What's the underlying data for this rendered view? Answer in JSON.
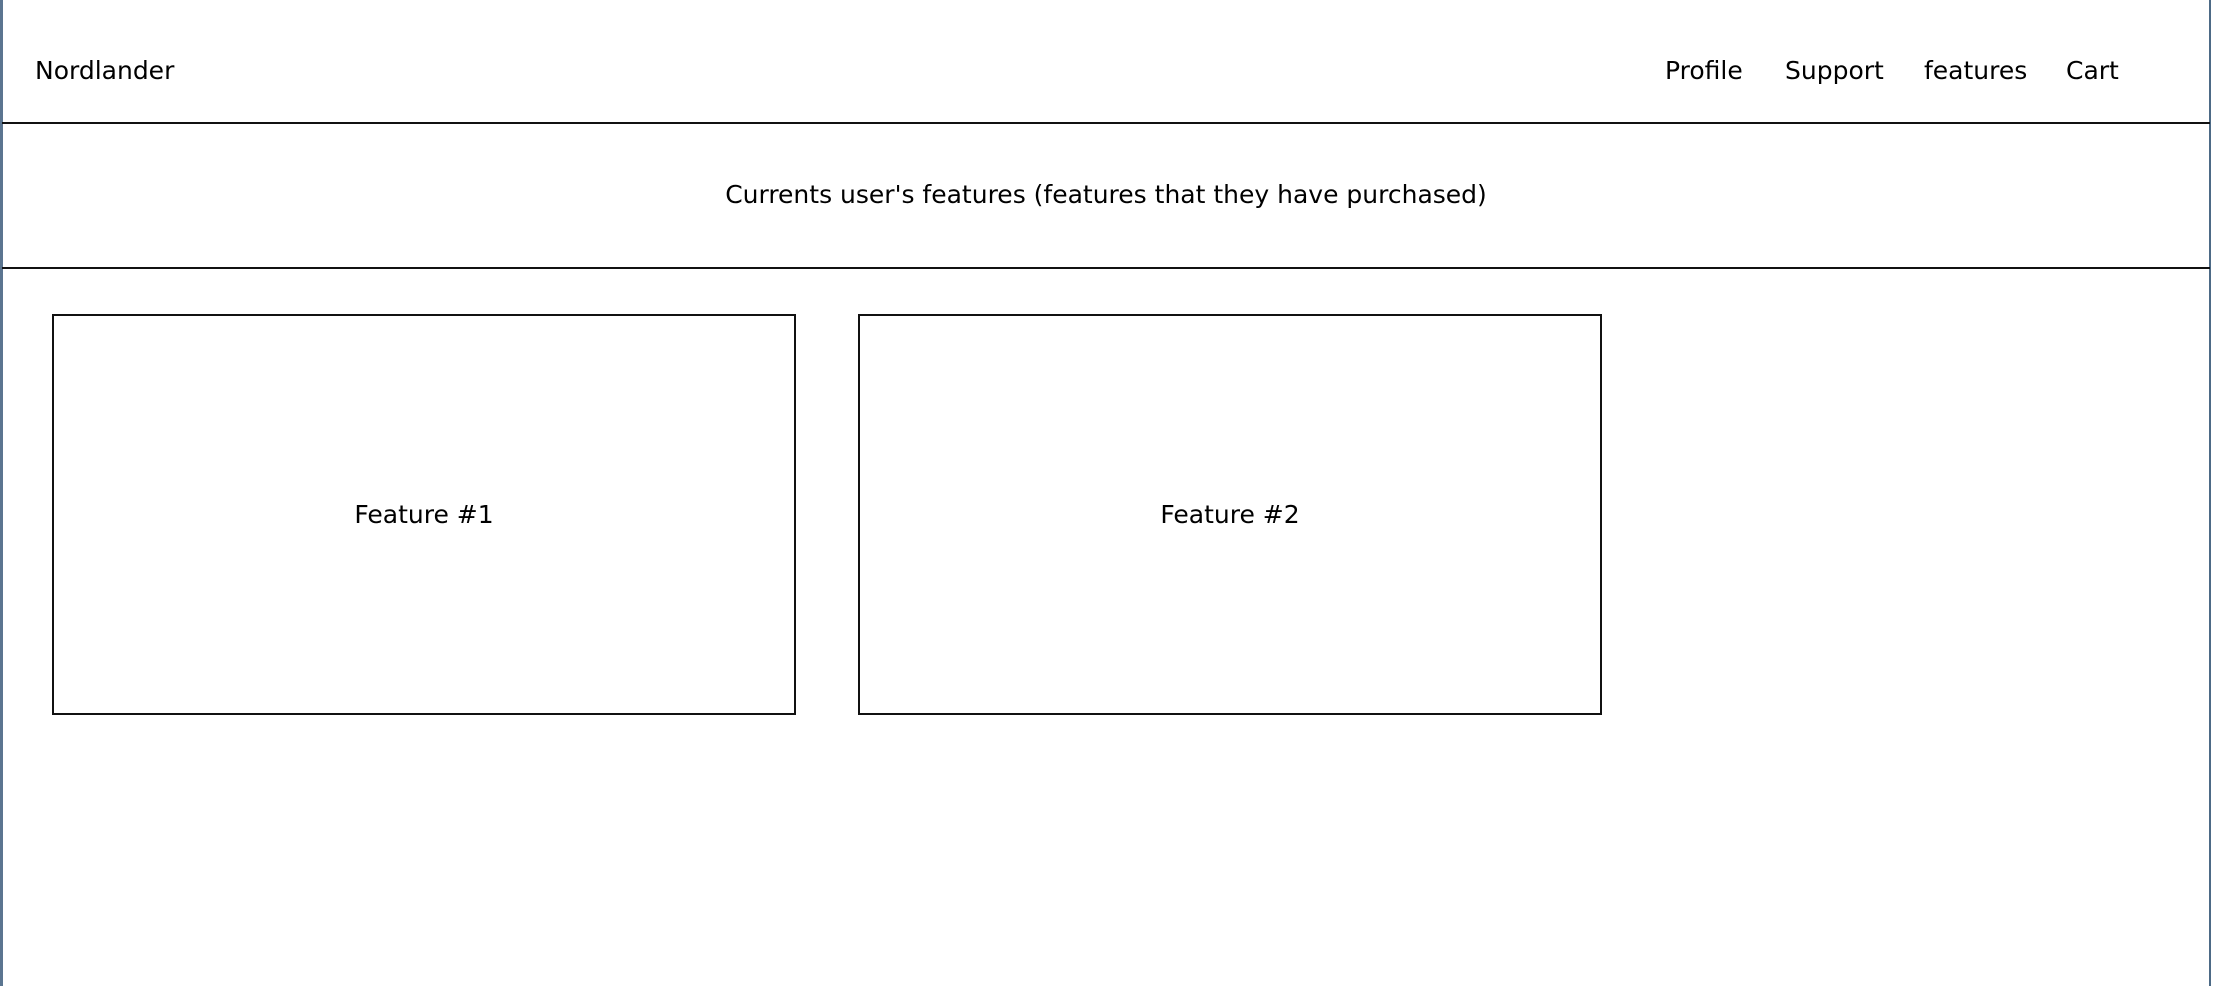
{
  "header": {
    "brand": "Nordlander",
    "nav": {
      "profile": "Profile",
      "support": "Support",
      "features": "features",
      "cart": "Cart"
    }
  },
  "banner": {
    "text": "Currents user's features (features that they have purchased)"
  },
  "features": [
    {
      "label": "Feature #1"
    },
    {
      "label": "Feature #2"
    }
  ]
}
